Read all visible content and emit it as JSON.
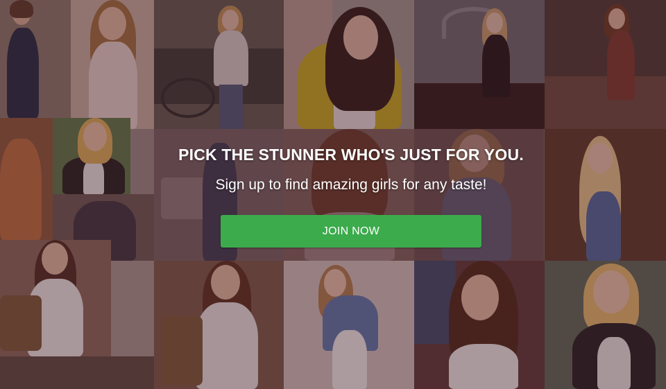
{
  "hero": {
    "headline": "PICK THE STUNNER WHO'S JUST FOR YOU.",
    "subline": "Sign up to find amazing girls for any taste!",
    "cta_label": "JOIN NOW"
  },
  "colors": {
    "cta": "#3cab4c",
    "overlay": "#461c26",
    "text": "#ffffff"
  }
}
